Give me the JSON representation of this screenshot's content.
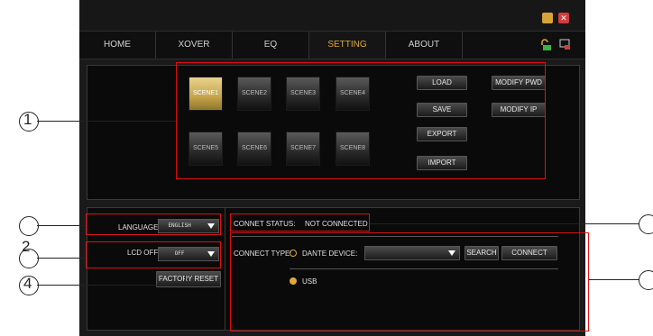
{
  "nav": {
    "tabs": [
      {
        "label": "HOME",
        "active": false
      },
      {
        "label": "XOVER",
        "active": false
      },
      {
        "label": "EQ",
        "active": false
      },
      {
        "label": "SETTING",
        "active": true
      },
      {
        "label": "ABOUT",
        "active": false
      }
    ],
    "icons": [
      "lock-icon",
      "network-icon"
    ]
  },
  "window_controls": {
    "minimize_icon": "minimize-icon",
    "close_icon": "close-icon"
  },
  "scenes": [
    {
      "label": "SCENE1",
      "active": true
    },
    {
      "label": "SCENE2",
      "active": false
    },
    {
      "label": "SCENE3",
      "active": false
    },
    {
      "label": "SCENE4",
      "active": false
    },
    {
      "label": "SCENE5",
      "active": false
    },
    {
      "label": "SCENE6",
      "active": false
    },
    {
      "label": "SCENE7",
      "active": false
    },
    {
      "label": "SCENE8",
      "active": false
    }
  ],
  "scene_actions": {
    "load": "LOAD",
    "save": "SAVE",
    "export": "EXPORT",
    "import": "IMPORT",
    "modify_pwd": "MODIFY PWD",
    "modify_ip": "MODIFY IP"
  },
  "settings": {
    "language_label": "LANGUAGE:",
    "language_value": "ENGLISH",
    "lcd_off_label": "LCD OFF:",
    "lcd_off_value": "OFF",
    "factory_reset": "FACTORY RESET"
  },
  "connection": {
    "status_label": "CONNET STATUS:",
    "status_value": "NOT CONNECTED",
    "type_label": "CONNECT TYPE:",
    "dante_label": "DANTE DEVICE:",
    "dante_selected": false,
    "dante_value": "",
    "search": "SEARCH",
    "connect": "CONNECT",
    "usb_label": "USB",
    "usb_selected": true
  },
  "annotations": {
    "a1": "1",
    "a2": "2",
    "a4": "4"
  },
  "colors": {
    "accent": "#e0a93a",
    "highlight_box": "#d11111",
    "background": "#1a1a1a"
  }
}
